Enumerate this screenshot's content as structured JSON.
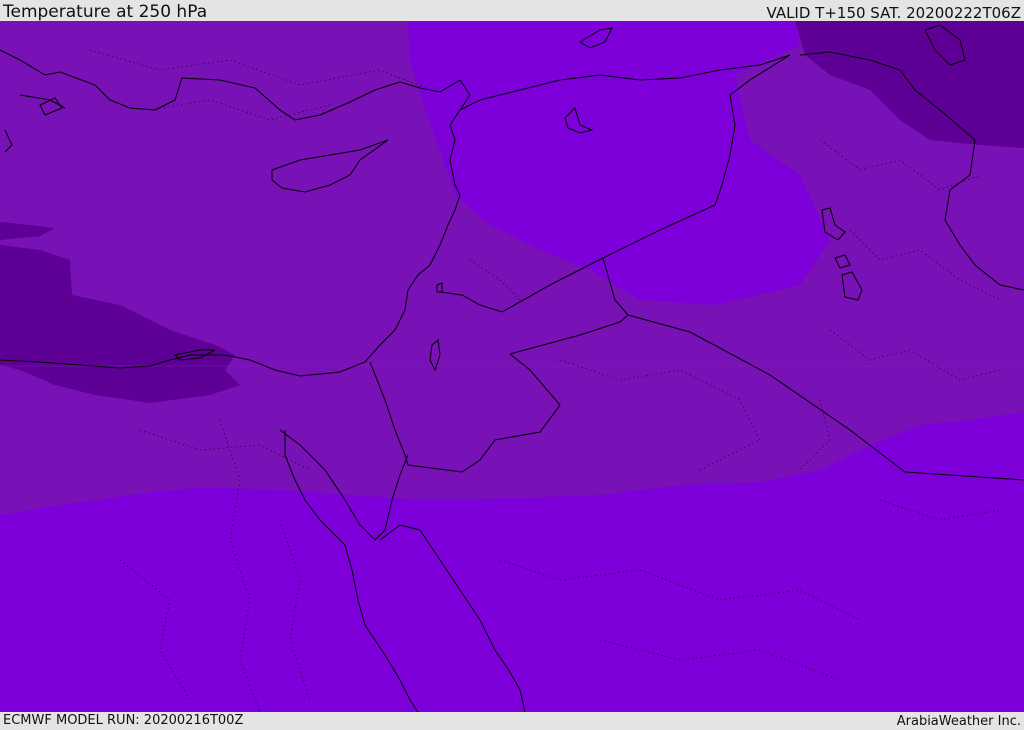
{
  "header": {
    "title": "Temperature at 250 hPa",
    "valid": "VALID T+150 SAT. 20200222T06Z"
  },
  "footer": {
    "model_run": "ECMWF MODEL RUN: 20200216T00Z",
    "credit": "ArabiaWeather Inc."
  },
  "map": {
    "field_colors": {
      "cold": "#5e0096",
      "mid": "#7811b6",
      "warm": "#7d00db"
    },
    "coastline_color": "#000000"
  }
}
